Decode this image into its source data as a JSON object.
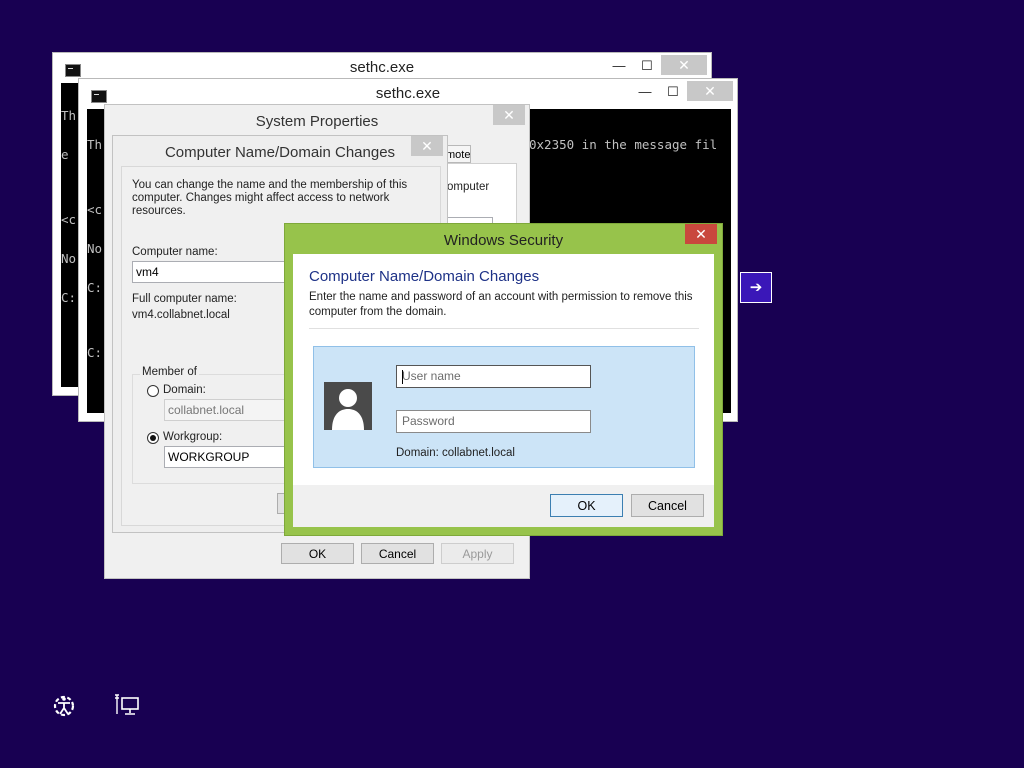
{
  "cmd_back": {
    "title": "sethc.exe",
    "minimize": "—",
    "maximize": "☐",
    "close": "✕",
    "lines": [
      "Th",
      "e",
      "",
      "<c",
      "No",
      "C:"
    ]
  },
  "cmd_front": {
    "title": "sethc.exe",
    "minimize": "—",
    "maximize": "☐",
    "close": "✕",
    "lines_left": [
      "Th",
      "",
      "<c",
      "No",
      "C:",
      "",
      "C:"
    ],
    "lines_right": [
      "0x2350 in the message fil",
      "",
      "",
      "",
      "",
      "."
    ]
  },
  "system_properties": {
    "title": "System Properties",
    "close": "✕",
    "partial_tab": "mote",
    "partial_text": "omputer",
    "ok": "OK",
    "cancel": "Cancel",
    "apply": "Apply"
  },
  "computer_name_dialog": {
    "title": "Computer Name/Domain Changes",
    "close": "✕",
    "description": "You can change the name and the membership of this computer. Changes might affect access to network resources.",
    "computer_name_label": "Computer name:",
    "computer_name_value": "vm4",
    "full_name_label": "Full computer name:",
    "full_name_value": "vm4.collabnet.local",
    "member_of_label": "Member of",
    "domain_label": "Domain:",
    "domain_value": "collabnet.local",
    "workgroup_label": "Workgroup:",
    "workgroup_value": "WORKGROUP"
  },
  "windows_security": {
    "title": "Windows Security",
    "close": "✕",
    "heading": "Computer Name/Domain Changes",
    "message": "Enter the name and password of an account with permission to remove this computer from the domain.",
    "username_placeholder": "User name",
    "password_placeholder": "Password",
    "domain_text": "Domain: collabnet.local",
    "ok": "OK",
    "cancel": "Cancel"
  },
  "taskbar": {
    "arrow": "➔",
    "ease_icon": "ease-of-access-icon",
    "network_icon": "network-icon"
  },
  "colors": {
    "background": "#180052",
    "security_frame": "#97c34b",
    "close_red": "#c9483d",
    "credential_panel": "#cce4f7",
    "heading_blue": "#1e3287"
  }
}
